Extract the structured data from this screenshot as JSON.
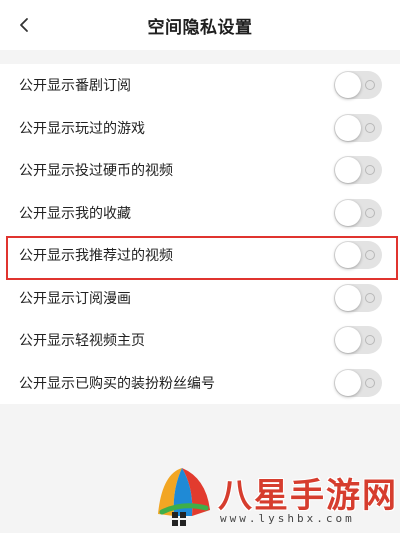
{
  "header": {
    "title": "空间隐私设置"
  },
  "settings": [
    {
      "label": "公开显示番剧订阅",
      "enabled": false
    },
    {
      "label": "公开显示玩过的游戏",
      "enabled": false
    },
    {
      "label": "公开显示投过硬币的视频",
      "enabled": false
    },
    {
      "label": "公开显示我的收藏",
      "enabled": false
    },
    {
      "label": "公开显示我推荐过的视频",
      "enabled": false,
      "highlighted": true
    },
    {
      "label": "公开显示订阅漫画",
      "enabled": false
    },
    {
      "label": "公开显示轻视频主页",
      "enabled": false
    },
    {
      "label": "公开显示已购买的装扮粉丝编号",
      "enabled": false
    }
  ],
  "watermark": {
    "title": "八星手游网",
    "url": "www.lyshbx.com"
  },
  "colors": {
    "highlight": "#e0342f",
    "toggle_off": "#e3e3e3"
  }
}
